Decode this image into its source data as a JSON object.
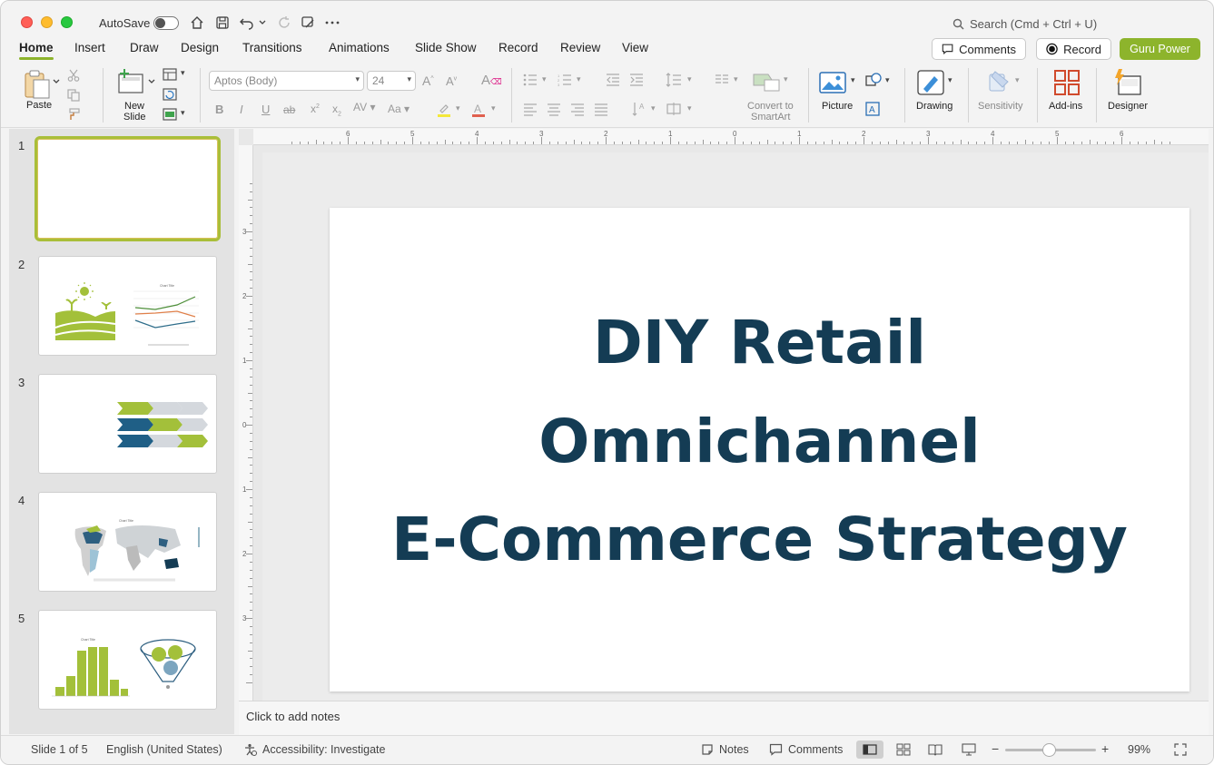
{
  "titlebar": {
    "autosave_label": "AutoSave",
    "search_placeholder": "Search (Cmd + Ctrl + U)"
  },
  "tabs": [
    "Home",
    "Insert",
    "Draw",
    "Design",
    "Transitions",
    "Animations",
    "Slide Show",
    "Record",
    "Review",
    "View"
  ],
  "active_tab": "Home",
  "actions": {
    "comments": "Comments",
    "record": "Record",
    "guru": "Guru Power"
  },
  "ribbon": {
    "paste": "Paste",
    "new_slide_1": "New",
    "new_slide_2": "Slide",
    "font_name": "Aptos (Body)",
    "font_size": "24",
    "convert_1": "Convert to",
    "convert_2": "SmartArt",
    "picture": "Picture",
    "drawing": "Drawing",
    "sensitivity": "Sensitivity",
    "addins": "Add-ins",
    "designer": "Designer"
  },
  "thumbnails": [
    {
      "num": "1"
    },
    {
      "num": "2"
    },
    {
      "num": "3"
    },
    {
      "num": "4"
    },
    {
      "num": "5"
    }
  ],
  "slide": {
    "line1": "DIY Retail",
    "line2": "Omnichannel",
    "line3": "E-Commerce Strategy"
  },
  "notes_placeholder": "Click to add notes",
  "status": {
    "slide_info": "Slide 1 of 5",
    "language": "English (United States)",
    "accessibility": "Accessibility: Investigate",
    "notes": "Notes",
    "comments": "Comments",
    "zoom": "99%"
  },
  "colors": {
    "accent_green": "#8db42c",
    "title_navy": "#143c54"
  }
}
